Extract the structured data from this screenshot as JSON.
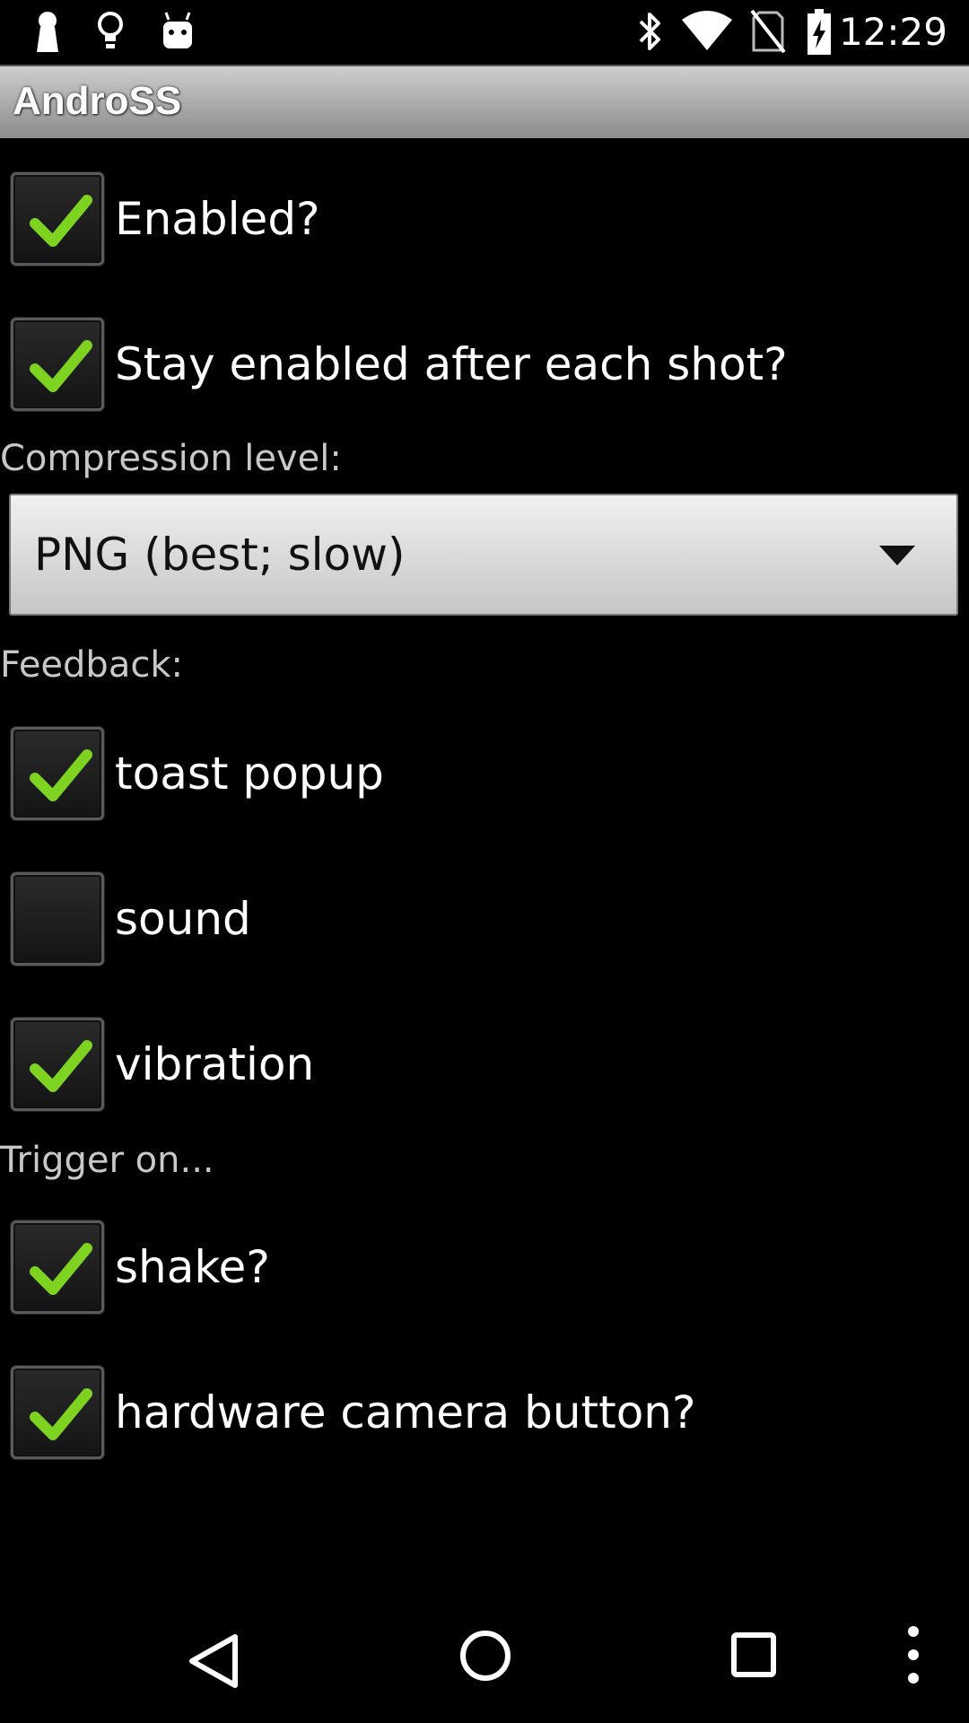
{
  "status_bar": {
    "time": "12:29",
    "left_icons": [
      "keyhole-icon",
      "lightbulb-icon",
      "android-icon"
    ],
    "right_icons": [
      "bluetooth-icon",
      "wifi-icon",
      "no-sim-icon",
      "battery-charging-icon"
    ]
  },
  "app": {
    "title": "AndroSS"
  },
  "settings": {
    "enabled": {
      "label": "Enabled?",
      "checked": true
    },
    "stay_enabled": {
      "label": "Stay enabled after each shot?",
      "checked": true
    },
    "compression": {
      "label": "Compression level:",
      "selected": "PNG (best; slow)"
    },
    "feedback": {
      "label": "Feedback:",
      "toast": {
        "label": "toast popup",
        "checked": true
      },
      "sound": {
        "label": "sound",
        "checked": false
      },
      "vibration": {
        "label": "vibration",
        "checked": true
      }
    },
    "trigger": {
      "label": "Trigger on...",
      "shake": {
        "label": "shake?",
        "checked": true
      },
      "camera": {
        "label": "hardware camera button?",
        "checked": true
      }
    }
  },
  "nav_bar": {
    "buttons": [
      "back-icon",
      "home-icon",
      "recents-icon",
      "overflow-menu-icon"
    ]
  },
  "colors": {
    "check": "#7ed321",
    "titlebar_top": "#cfcfcf",
    "titlebar_bottom": "#8c8c8c"
  }
}
